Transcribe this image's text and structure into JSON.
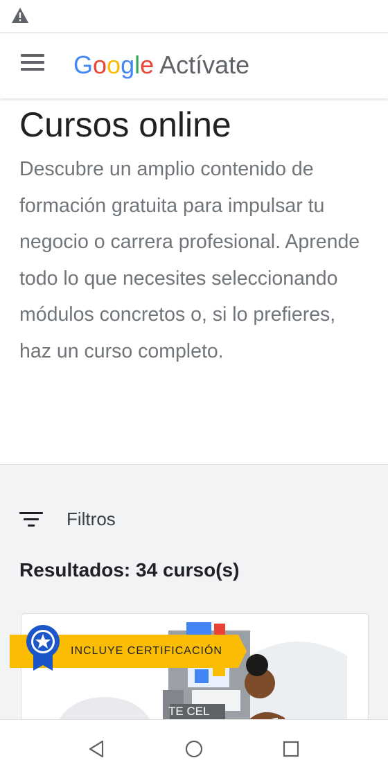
{
  "status_bar": {
    "icons": [
      "warning-icon"
    ]
  },
  "app_bar": {
    "menu_icon": "hamburger-menu-icon",
    "brand": {
      "google": [
        "G",
        "o",
        "o",
        "g",
        "l",
        "e"
      ],
      "product": "Actívate"
    },
    "brand_colors": [
      "#4285F4",
      "#EA4335",
      "#FBBC05",
      "#4285F4",
      "#34A853",
      "#EA4335"
    ]
  },
  "hero": {
    "title": "Cursos online",
    "description": "Descubre un amplio contenido de formación gratuita para impulsar tu negocio o carrera profesional. Aprende todo lo que necesites seleccionando módulos concretos o, si lo prefieres, haz un curso completo."
  },
  "filters": {
    "icon": "filter-icon",
    "label": "Filtros"
  },
  "results": {
    "label": "Resultados: 34 curso(s)"
  },
  "course_card": {
    "badge": {
      "icon": "certification-badge-icon",
      "label": "INCLUYE CERTIFICACIÓN",
      "color": "#FBBC04"
    },
    "image_text": "TE CEL"
  },
  "nav_bar": {
    "buttons": [
      "back-icon",
      "home-icon",
      "recents-icon"
    ]
  },
  "colors": {
    "accent_yellow": "#FBBC04",
    "badge_blue": "#1A56C8",
    "text_primary": "#202124",
    "text_secondary": "#70757a"
  }
}
